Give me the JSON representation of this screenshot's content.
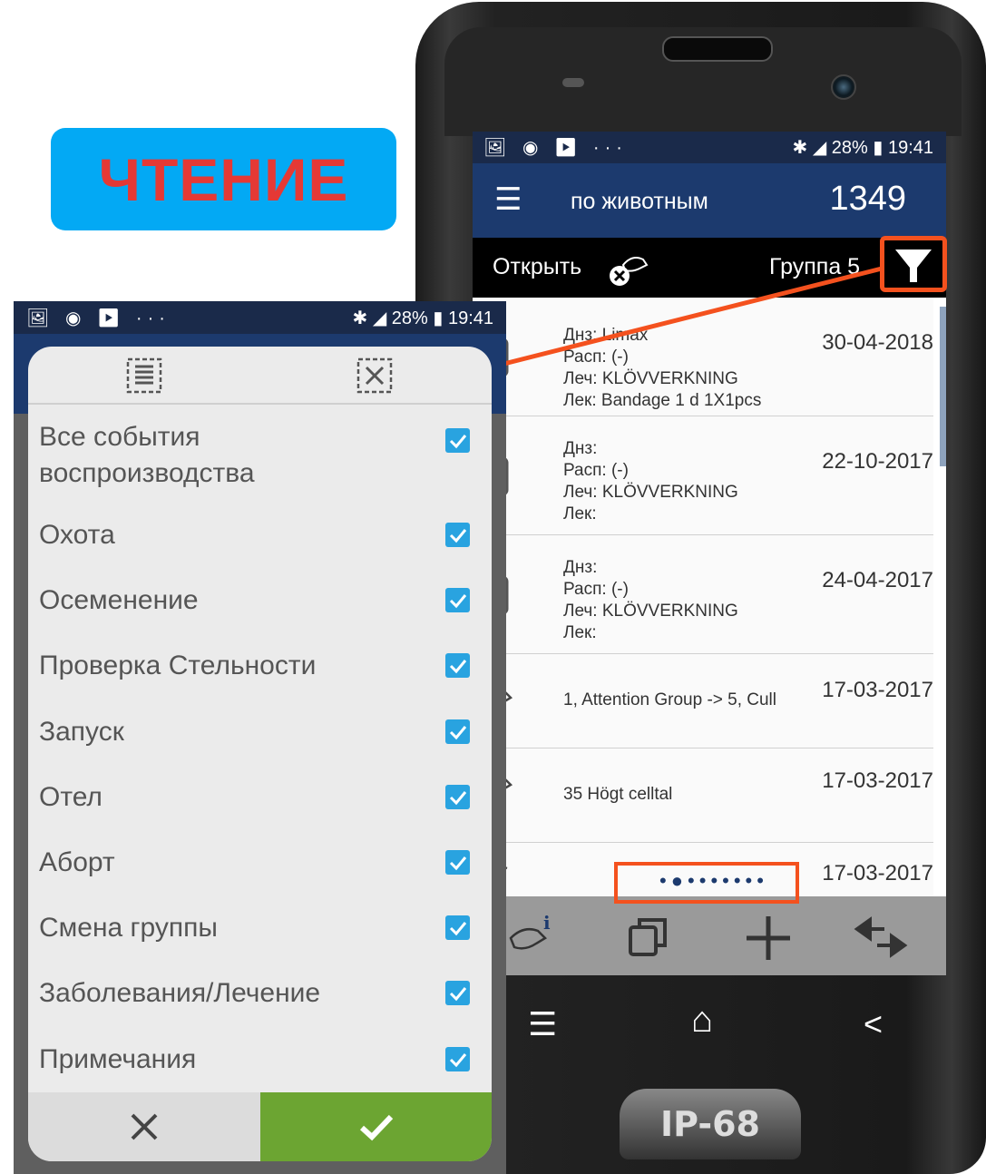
{
  "title_badge": "ЧТЕНИЕ",
  "colors": {
    "badge_bg": "#03a9f4",
    "badge_text": "#e53935",
    "app_bar": "#1c3a6e",
    "accent_check": "#29a3e0",
    "ok_green": "#6ca532",
    "highlight": "#f4511e"
  },
  "phone": {
    "status": {
      "left_icons": "🖼 ◉ ▶ ···",
      "right": "✱ ◢ 28% ▮ 19:41"
    },
    "app_bar": {
      "title": "по животным",
      "count": "1349",
      "menu_icon": "menu-icon"
    },
    "sub_bar": {
      "open_label": "Открыть",
      "group_label": "Группа 5",
      "filter_icon": "funnel-icon"
    },
    "events": [
      {
        "icon": "medical-kit-icon",
        "lines": [
          "Днз: Limax",
          "Расп: (-)",
          "Леч: KLÖVVERKNING",
          "Лек: Bandage 1 d 1X1pcs"
        ],
        "date": "30-04-2018"
      },
      {
        "icon": "medical-kit-icon",
        "lines": [
          "Днз:",
          "Расп: (-)",
          "Леч: KLÖVVERKNING",
          "Лек:"
        ],
        "date": "22-10-2017"
      },
      {
        "icon": "medical-kit-icon",
        "lines": [
          "Днз:",
          "Расп: (-)",
          "Леч: KLÖVVERKNING",
          "Лек:"
        ],
        "date": "24-04-2017"
      },
      {
        "icon": "cow-group-change-icon",
        "text": "1, Attention Group -> 5, Cull",
        "date": "17-03-2017"
      },
      {
        "icon": "cow-remark-icon",
        "text": "35 Högt celltal",
        "date": "17-03-2017"
      },
      {
        "icon": "partial-icon",
        "text": "",
        "date": "17-03-2017"
      }
    ],
    "pager_dots": "•●•••••••",
    "bottom_icons": [
      "cow-info-icon",
      "copy-icon",
      "add-icon",
      "swap-icon"
    ],
    "nav": {
      "menu": "☰",
      "home": "⌂",
      "back": "<"
    },
    "ip_badge": "IP-68"
  },
  "overlay": {
    "status": {
      "left_icons": "🖼 ◉ ▶ ···",
      "right": "✱ ◢ 28% ▮ 19:41"
    },
    "dialog": {
      "select_all_icon": "select-all-icon",
      "deselect_all_icon": "deselect-all-icon",
      "options": [
        {
          "label": "Все события воспроизводства",
          "checked": true
        },
        {
          "label": "Охота",
          "checked": true
        },
        {
          "label": "Осеменение",
          "checked": true
        },
        {
          "label": "Проверка Стельности",
          "checked": true
        },
        {
          "label": "Запуск",
          "checked": true
        },
        {
          "label": "Отел",
          "checked": true
        },
        {
          "label": "Аборт",
          "checked": true
        },
        {
          "label": "Смена группы",
          "checked": true
        },
        {
          "label": "Заболевания/Лечение",
          "checked": true
        },
        {
          "label": "Примечания",
          "checked": true
        }
      ],
      "cancel_icon": "close-icon",
      "ok_icon": "check-icon"
    }
  }
}
